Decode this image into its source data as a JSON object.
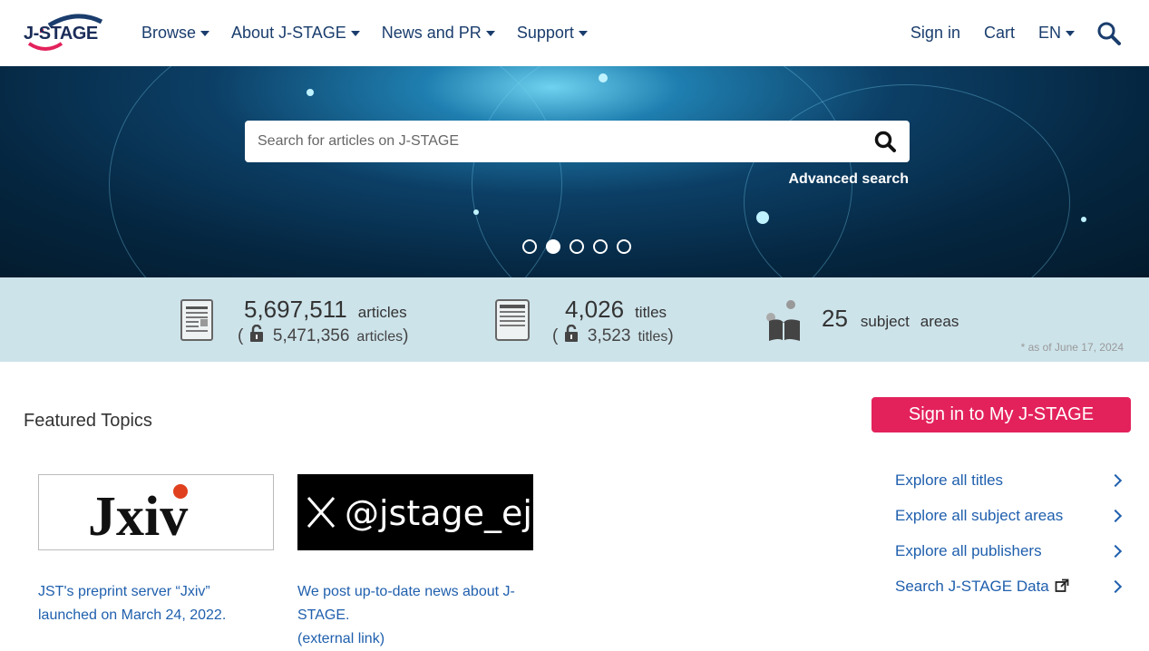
{
  "header": {
    "logo_text": "J-STAGE",
    "nav": [
      {
        "label": "Browse"
      },
      {
        "label": "About J-STAGE"
      },
      {
        "label": "News and PR"
      },
      {
        "label": "Support"
      }
    ],
    "right": {
      "signin": "Sign in",
      "cart": "Cart",
      "lang": "EN"
    }
  },
  "hero": {
    "search_placeholder": "Search for articles on J-STAGE",
    "advanced_search": "Advanced search",
    "carousel": {
      "count": 5,
      "active_index": 1
    }
  },
  "stats": {
    "articles": {
      "count": "5,697,511",
      "unit": "articles",
      "open_count": "5,471,356",
      "open_unit": "articles"
    },
    "titles": {
      "count": "4,026",
      "unit": "titles",
      "open_count": "3,523",
      "open_unit": "titles"
    },
    "subjects": {
      "count": "25",
      "unit_a": "subject",
      "unit_b": "areas"
    },
    "as_of": "* as of June 17, 2024"
  },
  "featured": {
    "title": "Featured Topics",
    "cards": [
      {
        "image_text": "Jxiv",
        "caption_1": "JST's preprint server “Jxiv”",
        "caption_2": "launched on March 24, 2022."
      },
      {
        "image_text": "@jstage_ej",
        "caption_1": "We post up-to-date news about J-",
        "caption_2": "STAGE.",
        "caption_3": "(external link)"
      }
    ]
  },
  "sidebar": {
    "signin_button": "Sign in to My J-STAGE",
    "links": [
      {
        "label": "Explore all titles"
      },
      {
        "label": "Explore all subject areas"
      },
      {
        "label": "Explore all publishers"
      },
      {
        "label": "Search J-STAGE Data"
      }
    ]
  },
  "colors": {
    "brand_navy": "#1a3d6d",
    "accent_pink": "#e3225c",
    "link_blue": "#1f5fad",
    "stats_band": "#cde3ea"
  }
}
